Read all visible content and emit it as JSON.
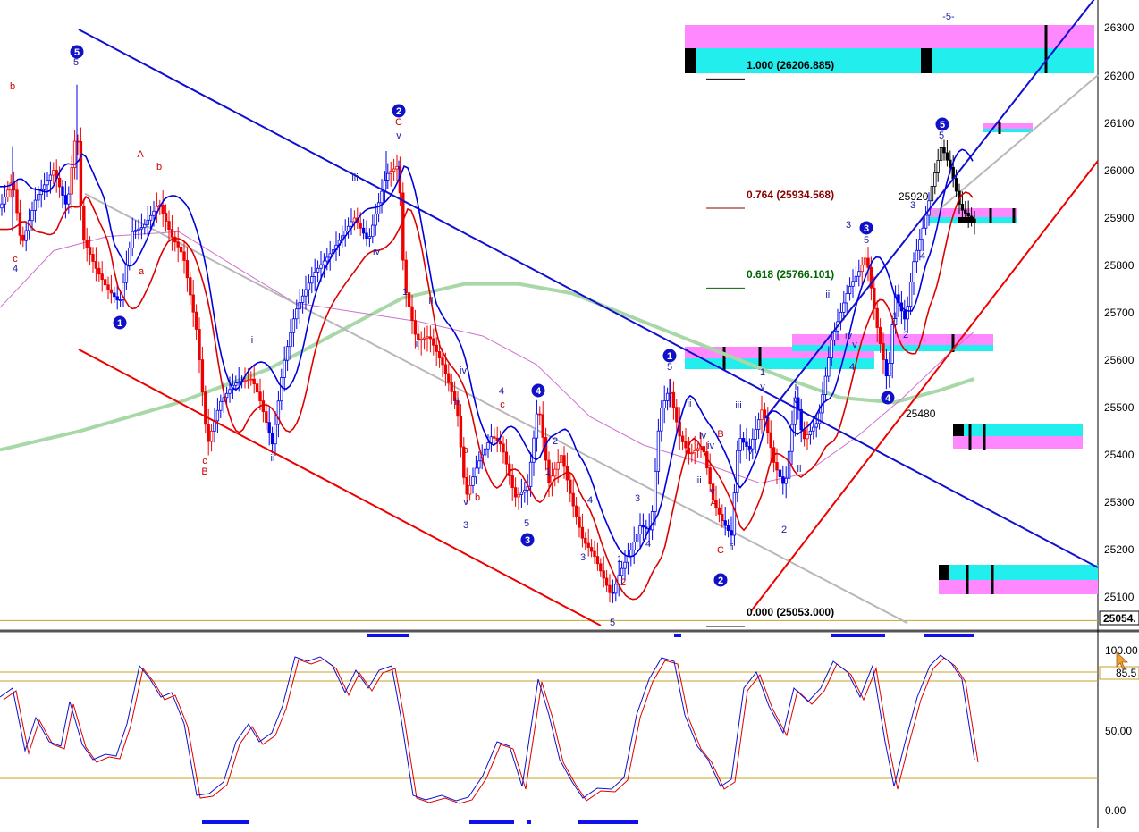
{
  "chart_data": {
    "type": "candlestick",
    "price_axis": {
      "ticks": [
        26300,
        26200,
        26100,
        26000,
        25900,
        25800,
        25700,
        25600,
        25500,
        25400,
        25300,
        25200,
        25100
      ],
      "last_price_label": "25054.",
      "ylim": [
        25030,
        26380
      ]
    },
    "oscillator_axis": {
      "ticks": [
        "100.00",
        "50.00",
        "0.00"
      ],
      "level_label": "85.5",
      "levels": [
        100,
        85.5,
        50,
        0
      ],
      "ylim": [
        -5,
        108
      ]
    },
    "fibonacci_levels": [
      {
        "label": "1.000 (26206.885)",
        "price": 26206.885,
        "color": "#000000"
      },
      {
        "label": "0.764 (25934.568)",
        "price": 25934.568,
        "color": "#8b0000"
      },
      {
        "label": "0.618 (25766.101)",
        "price": 25766.101,
        "color": "#006400"
      },
      {
        "label": "0.000 (25053.000)",
        "price": 25053.0,
        "color": "#000000"
      }
    ],
    "price_annotations": [
      "25920",
      "25480"
    ],
    "wave_labels": [
      {
        "text": "5",
        "color": "blue",
        "x": 85,
        "y": 73
      },
      {
        "text": "b",
        "color": "red",
        "x": 14,
        "y": 100
      },
      {
        "text": "c",
        "color": "red",
        "x": 17,
        "y": 293
      },
      {
        "text": "4",
        "color": "blue",
        "x": 17,
        "y": 304
      },
      {
        "text": "A",
        "color": "red",
        "x": 157,
        "y": 176
      },
      {
        "text": "b",
        "color": "red",
        "x": 178,
        "y": 190
      },
      {
        "text": "a",
        "color": "red",
        "x": 158,
        "y": 307
      },
      {
        "text": "c",
        "color": "red",
        "x": 229,
        "y": 519
      },
      {
        "text": "B",
        "color": "red",
        "x": 229,
        "y": 531
      },
      {
        "text": "i",
        "color": "blue",
        "x": 282,
        "y": 384
      },
      {
        "text": "ii",
        "color": "blue",
        "x": 305,
        "y": 516
      },
      {
        "text": "iii",
        "color": "blue",
        "x": 397,
        "y": 202
      },
      {
        "text": "iv",
        "color": "blue",
        "x": 421,
        "y": 285
      },
      {
        "text": "C",
        "color": "red",
        "x": 446,
        "y": 140
      },
      {
        "text": "v",
        "color": "blue",
        "x": 446,
        "y": 155
      },
      {
        "text": "1",
        "color": "blue",
        "x": 453,
        "y": 330
      },
      {
        "text": "ii",
        "color": "blue",
        "x": 482,
        "y": 340
      },
      {
        "text": "i",
        "color": "blue",
        "x": 466,
        "y": 388
      },
      {
        "text": "ii",
        "color": "blue",
        "x": 511,
        "y": 453
      },
      {
        "text": "iv",
        "color": "blue",
        "x": 518,
        "y": 418
      },
      {
        "text": "4",
        "color": "blue",
        "x": 561,
        "y": 441
      },
      {
        "text": "c",
        "color": "red",
        "x": 562,
        "y": 456
      },
      {
        "text": "a",
        "color": "red",
        "x": 521,
        "y": 507
      },
      {
        "text": "b",
        "color": "red",
        "x": 534,
        "y": 560
      },
      {
        "text": "v",
        "color": "blue",
        "x": 521,
        "y": 565
      },
      {
        "text": "3",
        "color": "blue",
        "x": 521,
        "y": 591
      },
      {
        "text": "5",
        "color": "blue",
        "x": 589,
        "y": 589
      },
      {
        "text": "2",
        "color": "blue",
        "x": 621,
        "y": 497
      },
      {
        "text": "1",
        "color": "blue",
        "x": 613,
        "y": 531
      },
      {
        "text": "4",
        "color": "blue",
        "x": 660,
        "y": 563
      },
      {
        "text": "3",
        "color": "blue",
        "x": 652,
        "y": 627
      },
      {
        "text": "1",
        "color": "blue",
        "x": 693,
        "y": 629
      },
      {
        "text": "2",
        "color": "red",
        "x": 697,
        "y": 655
      },
      {
        "text": "3",
        "color": "blue",
        "x": 713,
        "y": 561
      },
      {
        "text": "4",
        "color": "blue",
        "x": 725,
        "y": 612
      },
      {
        "text": "5",
        "color": "blue",
        "x": 685,
        "y": 700
      },
      {
        "text": "5",
        "color": "blue",
        "x": 749,
        "y": 414
      },
      {
        "text": "ii",
        "color": "blue",
        "x": 771,
        "y": 455
      },
      {
        "text": "iv",
        "color": "blue",
        "x": 786,
        "y": 491
      },
      {
        "text": "iv",
        "color": "blue",
        "x": 795,
        "y": 502
      },
      {
        "text": "B",
        "color": "red",
        "x": 806,
        "y": 489
      },
      {
        "text": "iii",
        "color": "blue",
        "x": 781,
        "y": 541
      },
      {
        "text": "v",
        "color": "blue",
        "x": 797,
        "y": 553
      },
      {
        "text": "A",
        "color": "red",
        "x": 798,
        "y": 566
      },
      {
        "text": "C",
        "color": "red",
        "x": 806,
        "y": 619
      },
      {
        "text": "ii",
        "color": "blue",
        "x": 818,
        "y": 616
      },
      {
        "text": "iii",
        "color": "blue",
        "x": 826,
        "y": 457
      },
      {
        "text": "iv",
        "color": "blue",
        "x": 838,
        "y": 508
      },
      {
        "text": "1",
        "color": "blue",
        "x": 853,
        "y": 420
      },
      {
        "text": "v",
        "color": "blue",
        "x": 853,
        "y": 436
      },
      {
        "text": "i",
        "color": "blue",
        "x": 890,
        "y": 436
      },
      {
        "text": "v",
        "color": "blue",
        "x": 890,
        "y": 451
      },
      {
        "text": "ii",
        "color": "blue",
        "x": 894,
        "y": 528
      },
      {
        "text": "2",
        "color": "blue",
        "x": 877,
        "y": 596
      },
      {
        "text": "3",
        "color": "blue",
        "x": 949,
        "y": 255
      },
      {
        "text": "5",
        "color": "blue",
        "x": 969,
        "y": 272
      },
      {
        "text": "iii",
        "color": "blue",
        "x": 927,
        "y": 333
      },
      {
        "text": "iv",
        "color": "blue",
        "x": 949,
        "y": 379
      },
      {
        "text": "v",
        "color": "blue",
        "x": 956,
        "y": 389
      },
      {
        "text": "4",
        "color": "blue",
        "x": 953,
        "y": 414
      },
      {
        "text": "1",
        "color": "blue",
        "x": 1001,
        "y": 357
      },
      {
        "text": "2",
        "color": "blue",
        "x": 1013,
        "y": 378
      },
      {
        "text": "3",
        "color": "blue",
        "x": 1021,
        "y": 233
      },
      {
        "text": "4",
        "color": "blue",
        "x": 1032,
        "y": 290
      },
      {
        "text": "5",
        "color": "blue",
        "x": 1053,
        "y": 155
      },
      {
        "text": "-5-",
        "color": "blue",
        "x": 1061,
        "y": 22
      }
    ],
    "circled_labels": [
      {
        "text": "5",
        "x": 86,
        "y": 58
      },
      {
        "text": "1",
        "x": 134,
        "y": 361
      },
      {
        "text": "2",
        "x": 446,
        "y": 124
      },
      {
        "text": "4",
        "x": 602,
        "y": 437
      },
      {
        "text": "3",
        "x": 590,
        "y": 604
      },
      {
        "text": "1",
        "x": 749,
        "y": 398
      },
      {
        "text": "2",
        "x": 806,
        "y": 649
      },
      {
        "text": "3",
        "x": 969,
        "y": 255
      },
      {
        "text": "4",
        "x": 993,
        "y": 445
      },
      {
        "text": "5",
        "x": 1054,
        "y": 139
      }
    ]
  }
}
